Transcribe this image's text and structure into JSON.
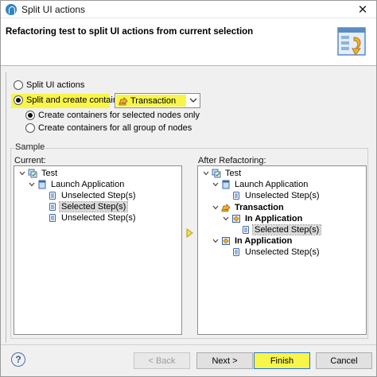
{
  "window": {
    "title": "Split UI actions",
    "close_glyph": "✕"
  },
  "header": {
    "heading": "Refactoring test to split UI actions from current selection"
  },
  "options": {
    "split_ui_actions": "Split UI actions",
    "split_and_create": "Split and create container:",
    "container_value": "Transaction",
    "selected_nodes_only": "Create containers for selected nodes only",
    "all_group_of_nodes": "Create containers for all group of nodes"
  },
  "sample": {
    "label": "Sample",
    "current_label": "Current:",
    "after_label": "After Refactoring:",
    "current_tree": {
      "test": "Test",
      "launch": "Launch Application",
      "unselected_1": "Unselected Step(s)",
      "selected": "Selected Step(s)",
      "unselected_2": "Unselected Step(s)"
    },
    "after_tree": {
      "test": "Test",
      "launch": "Launch Application",
      "unselected_1": "Unselected Step(s)",
      "transaction": "Transaction",
      "in_app_1": "In Application",
      "selected": "Selected Step(s)",
      "in_app_2": "In Application",
      "unselected_2": "Unselected Step(s)"
    }
  },
  "buttons": {
    "help": "?",
    "back": "< Back",
    "next": "Next >",
    "finish": "Finish",
    "cancel": "Cancel"
  },
  "colors": {
    "highlight": "#f7f54a",
    "accent": "#2a72d4"
  }
}
